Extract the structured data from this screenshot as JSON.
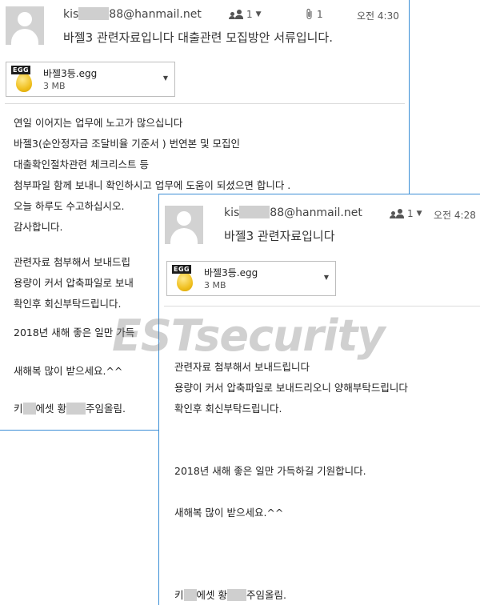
{
  "email1": {
    "sender_prefix": "kis",
    "sender_suffix": "88@hanmail.net",
    "recipients_count": "1",
    "attachment_count": "1",
    "time": "오전 4:30",
    "subject": "바젤3 관련자료입니다 대출관련 모집방안 서류입니다.",
    "attachment": {
      "name": "바젤3등.egg",
      "size": "3 MB",
      "badge": "EGG"
    },
    "body_lines": [
      "연일 이어지는 업무에 노고가 많으십니다",
      "바젤3(순안정자금 조달비율 기준서 ) 번연본 및 모집인",
      "대출확인절차관련 체크리스트 등",
      "첨부파일 함께 보내니 확인하시고 업무에 도움이 되셨으면 합니다 .",
      "오늘 하루도 수고하십시오.",
      "감사합니다.",
      "관련자료 첨부해서 보내드립",
      "용량이 커서 압축파일로 보내",
      "확인후 회신부탁드립니다.",
      "2018년 새해 좋은 일만 가득",
      "새해복 많이 받으세요.^^"
    ],
    "signature": {
      "part1": "키",
      "part2": "에셋 황",
      "part3": "주임올림."
    }
  },
  "email2": {
    "sender_prefix": "kis",
    "sender_suffix": "88@hanmail.net",
    "recipients_count": "1",
    "time": "오전 4:28",
    "subject": "바젤3 관련자료입니다",
    "attachment": {
      "name": "바젤3등.egg",
      "size": "3 MB",
      "badge": "EGG"
    },
    "body_lines": [
      "관련자료 첨부해서 보내드립니다",
      "용량이 커서 압축파일로 보내드리오니 양해부탁드립니다",
      "확인후 회신부탁드립니다.",
      "2018년 새해 좋은 일만 가득하길 기원합니다.",
      "새해복 많이 받으세요.^^"
    ],
    "signature": {
      "part1": "키",
      "part2": "에셋 황",
      "part3": "주임올림."
    }
  },
  "watermark": "ESTsecurity",
  "colors": {
    "window_border": "#3b8ed6",
    "mask_gray": "#cfcfcf",
    "avatar_bg": "#d2d2d2"
  }
}
